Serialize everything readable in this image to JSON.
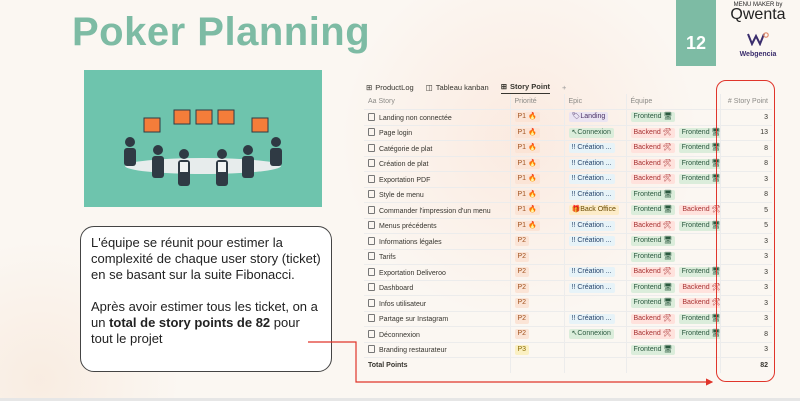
{
  "slide": {
    "title": "Poker Planning",
    "page_number": "12",
    "brand": {
      "small": "MENU MAKER by",
      "name": "Qwenta",
      "sub": "Webgencia"
    },
    "colors": {
      "accent": "#7dbba4",
      "red": "#e0352b",
      "illustration_bg": "#6ec4ad"
    }
  },
  "textbox": {
    "p1": "L'équipe se réunit pour estimer la complexité de chaque user story (ticket) en se basant sur la suite Fibonacci.",
    "p2_start": "Après avoir estimer tous les ticket, on a un ",
    "p2_bold": "total de story points de 82",
    "p2_end": " pour tout le projet"
  },
  "tabs": [
    {
      "label": "ProductLog",
      "icon": "table-icon"
    },
    {
      "label": "Tableau kanban",
      "icon": "board-icon"
    },
    {
      "label": "Story Point",
      "icon": "table-icon",
      "active": true
    },
    {
      "label": "+",
      "icon": "plus-icon"
    }
  ],
  "columns": [
    "Aa Story",
    "Priorité",
    "Epic",
    "Équipe",
    "# Story Point"
  ],
  "rows": [
    {
      "story": "Landing non connectée",
      "priority": "P1 🔥",
      "epic": "🏷Landing",
      "teams": [
        "Frontend 🖥"
      ],
      "points": "3"
    },
    {
      "story": "Page login",
      "priority": "P1 🔥",
      "epic": "↖Connexion",
      "teams": [
        "Backend 🛠",
        "Frontend 🖥"
      ],
      "points": "13"
    },
    {
      "story": "Catégorie de plat",
      "priority": "P1 🔥",
      "epic": "!! Création ...",
      "teams": [
        "Backend 🛠",
        "Frontend 🖥"
      ],
      "points": "8"
    },
    {
      "story": "Création de plat",
      "priority": "P1 🔥",
      "epic": "!! Création ...",
      "teams": [
        "Backend 🛠",
        "Frontend 🖥"
      ],
      "points": "8"
    },
    {
      "story": "Exportation PDF",
      "priority": "P1 🔥",
      "epic": "!! Création ...",
      "teams": [
        "Backend 🛠",
        "Frontend 🖥"
      ],
      "points": "3"
    },
    {
      "story": "Style de menu",
      "priority": "P1 🔥",
      "epic": "!! Création ...",
      "teams": [
        "Frontend 🖥"
      ],
      "points": "8"
    },
    {
      "story": "Commander l'impression d'un menu",
      "priority": "P1 🔥",
      "epic": "🎁Back Office",
      "teams": [
        "Frontend 🖥",
        "Backend 🛠"
      ],
      "points": "5"
    },
    {
      "story": "Menus précédents",
      "priority": "P1 🔥",
      "epic": "!! Création ...",
      "teams": [
        "Backend 🛠",
        "Frontend 🖥"
      ],
      "points": "5"
    },
    {
      "story": "Informations légales",
      "priority": "P2",
      "epic": "!! Création ...",
      "teams": [
        "Frontend 🖥"
      ],
      "points": "3"
    },
    {
      "story": "Tarifs",
      "priority": "P2",
      "epic": "",
      "teams": [
        "Frontend 🖥"
      ],
      "points": "3"
    },
    {
      "story": "Exportation Deliveroo",
      "priority": "P2",
      "epic": "!! Création ...",
      "teams": [
        "Backend 🛠",
        "Frontend 🖥"
      ],
      "points": "3"
    },
    {
      "story": "Dashboard",
      "priority": "P2",
      "epic": "!! Création ...",
      "teams": [
        "Frontend 🖥",
        "Backend 🛠"
      ],
      "points": "3"
    },
    {
      "story": "Infos utilisateur",
      "priority": "P2",
      "epic": "",
      "teams": [
        "Frontend 🖥",
        "Backend 🛠"
      ],
      "points": "3"
    },
    {
      "story": "Partage sur Instagram",
      "priority": "P2",
      "epic": "!! Création ...",
      "teams": [
        "Backend 🛠",
        "Frontend 🖥"
      ],
      "points": "3"
    },
    {
      "story": "Déconnexion",
      "priority": "P2",
      "epic": "↖Connexion",
      "teams": [
        "Backend 🛠",
        "Frontend 🖥"
      ],
      "points": "8"
    },
    {
      "story": "Branding restaurateur",
      "priority": "P3",
      "epic": "",
      "teams": [
        "Frontend 🖥"
      ],
      "points": "3"
    }
  ],
  "total": {
    "label": "Total Points",
    "value": "82"
  }
}
